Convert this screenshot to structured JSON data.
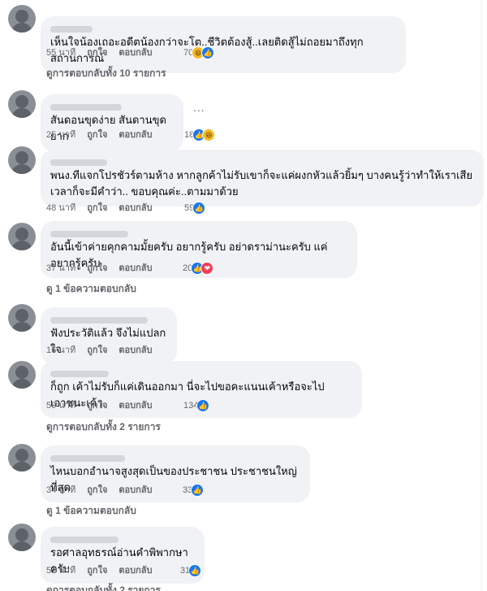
{
  "labels": {
    "like": "ถูกใจ",
    "reply": "ตอบกลับ",
    "more": "..."
  },
  "comments": [
    {
      "text": "เห็นใจน้องเถอะอดีตน้องกว่าจะโต..ชีวิตต้องสู้..เลยติดสู้ไม่ถอยมาถึงทุกสถานการณ์",
      "time": "55 นาที",
      "reaction_count": "70",
      "reactions": [
        "haha-icon",
        "like-icon"
      ],
      "replies": "ดูการตอบกลับทั้ง 10 รายการ"
    },
    {
      "text": "สันดอนขุดง่าย สันดานขุดยาก",
      "time": "25 นาที",
      "reaction_count": "18",
      "reactions": [
        "like-icon",
        "haha-icon"
      ],
      "replies": ""
    },
    {
      "text": "พนง.ทีแจกโปรชัวร์ตามห้าง หากลูกค้าไม่รับเขาก็จะแค่ผงกหัวแล้วยิ้มๆ บางคนรู้ว่าทำให้เราเสีย\nเวลาก็จะมีคำว่า.. ขอบคุณค่ะ..ตามมาด้วย",
      "time": "48 นาที",
      "reaction_count": "59",
      "reactions": [
        "like-icon"
      ],
      "replies": ""
    },
    {
      "text": "อันนี้เข้าค่ายคุกคามมั้ยครับ อยากรู้ครับ อย่าดราม่านะครับ แค่อยากรู้ครับ",
      "time": "37 นาที",
      "reaction_count": "20",
      "reactions": [
        "like-icon",
        "love-icon"
      ],
      "replies": "ดู 1 ข้อความตอบกลับ"
    },
    {
      "text": "ฟังประวัติแล้ว จึงไม่แปลกใจ",
      "time": "16 นาที",
      "reaction_count": "",
      "reactions": [],
      "replies": ""
    },
    {
      "text": "ก็ถูก เค้าไม่รับก็แค่เดินออกมา นี่จะไปขอคะแนนเค้าหรือจะไปเอาชนะเค้า",
      "time": "59 นาที",
      "reaction_count": "134",
      "reactions": [
        "like-icon"
      ],
      "replies": "ดูการตอบกลับทั้ง 2 รายการ"
    },
    {
      "text": "ไหนบอกอำนาจสูงสุดเป็นของประชาชน ประชาชนใหญ่ที่สุด",
      "time": "34 นาที",
      "reaction_count": "33",
      "reactions": [
        "like-icon"
      ],
      "replies": "ดู 1 ข้อความตอบกลับ"
    },
    {
      "text": "รอศาลอุทธรณ์อ่านคำพิพากษาครับ",
      "time": "51 นาที",
      "reaction_count": "31",
      "reactions": [
        "like-icon"
      ],
      "replies": "ดูการตอบกลับทั้ง 2 รายการ"
    }
  ]
}
